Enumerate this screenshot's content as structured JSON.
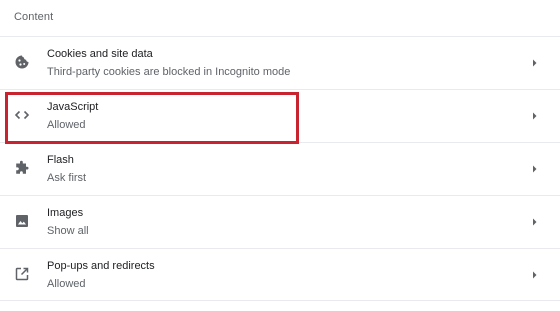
{
  "section": {
    "title": "Content"
  },
  "items": [
    {
      "label": "Cookies and site data",
      "sublabel": "Third-party cookies are blocked in Incognito mode",
      "icon": "cookie-icon"
    },
    {
      "label": "JavaScript",
      "sublabel": "Allowed",
      "icon": "code-brackets-icon"
    },
    {
      "label": "Flash",
      "sublabel": "Ask first",
      "icon": "puzzle-piece-icon"
    },
    {
      "label": "Images",
      "sublabel": "Show all",
      "icon": "image-icon"
    },
    {
      "label": "Pop-ups and redirects",
      "sublabel": "Allowed",
      "icon": "open-in-new-icon"
    }
  ],
  "colors": {
    "highlight_border": "#c8242f",
    "icon": "#5f6368",
    "text_primary": "#202124",
    "text_secondary": "#5f6368",
    "divider": "#e8eaed"
  }
}
